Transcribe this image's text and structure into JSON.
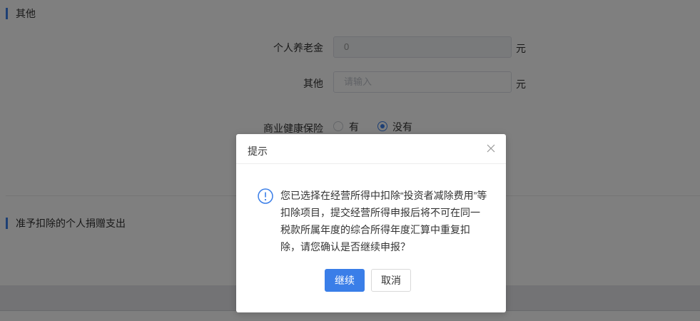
{
  "other_section": {
    "title": "其他",
    "pension": {
      "label": "个人养老金",
      "value": "0",
      "unit": "元"
    },
    "other": {
      "label": "其他",
      "placeholder": "请输入",
      "unit": "元"
    },
    "health_insurance": {
      "label": "商业健康保险",
      "options": [
        {
          "label": "有",
          "checked": false
        },
        {
          "label": "没有",
          "checked": true
        }
      ]
    }
  },
  "donation_section": {
    "title": "准予扣除的个人捐赠支出"
  },
  "dialog": {
    "title": "提示",
    "close_icon": "close-icon",
    "info_icon": "info-icon",
    "message": "您已选择在经营所得中扣除“投资者减除费用”等扣除项目，提交经营所得申报后将不可在同一税款所属年度的综合所得年度汇算中重复扣除，请您确认是否继续申报？",
    "confirm_label": "继续",
    "cancel_label": "取消"
  },
  "colors": {
    "accent": "#3a7ee8",
    "overlay": "rgba(0,0,0,0.5)"
  }
}
